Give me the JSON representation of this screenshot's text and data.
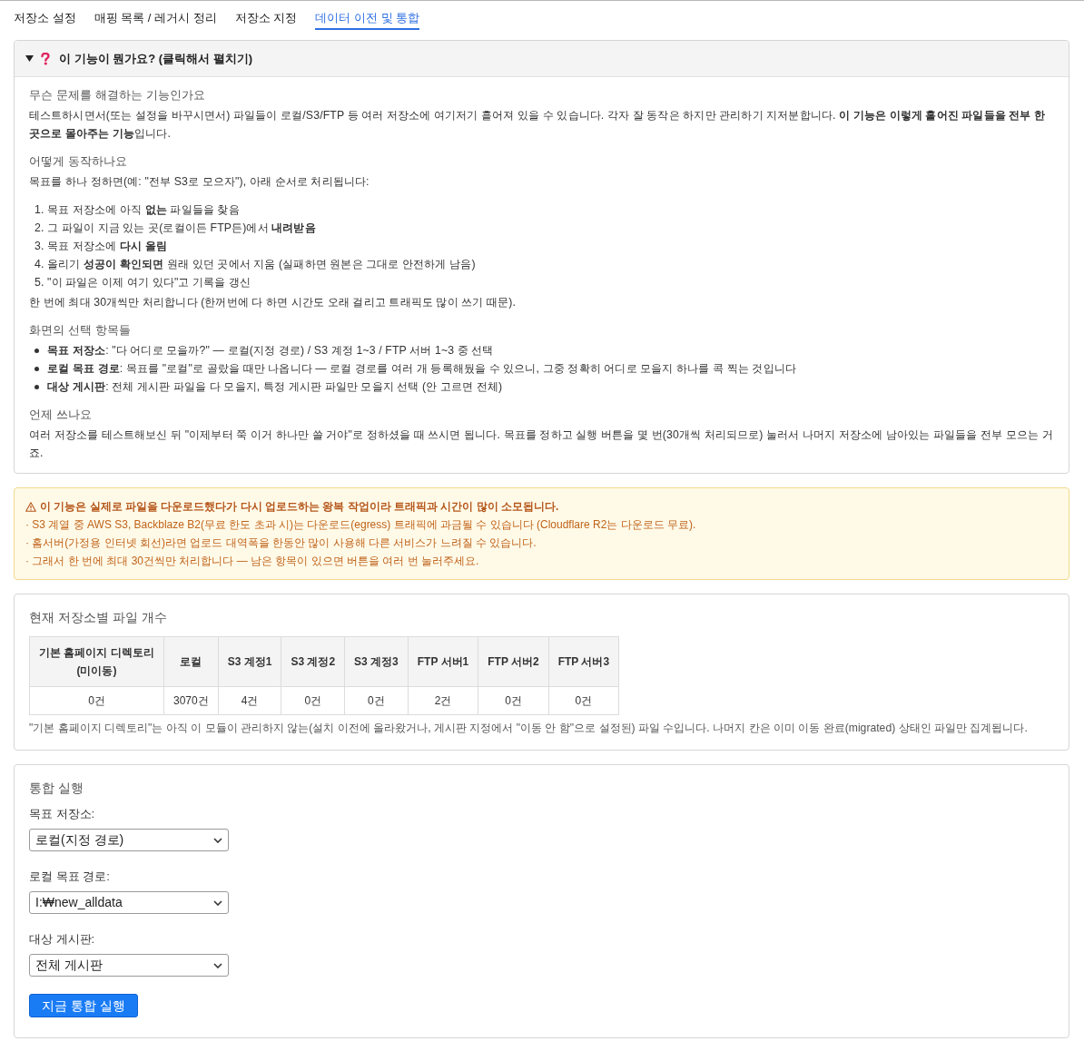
{
  "tabs": [
    {
      "label": "저장소 설정",
      "selected": false
    },
    {
      "label": "매핑 목록 / 레거시 정리",
      "selected": false
    },
    {
      "label": "저장소 지정",
      "selected": false
    },
    {
      "label": "데이터 이전 및 통합",
      "selected": true
    }
  ],
  "help_panel": {
    "summary": "이 기능이 뭔가요? (클릭해서 펼치기)",
    "expanded": true,
    "sections": [
      {
        "heading": "무슨 문제를 해결하는 기능인가요",
        "blocks": [
          {
            "kind": "paragraph",
            "text": "테스트하시면서(또는 설정을 바꾸시면서) 파일들이 로컬/S3/FTP 등 여러 저장소에 여기저기 흩어져 있을 수 있습니다. 각자 잘 동작은 하지만 관리하기 지저분합니다. **이 기능은 이렇게 흩어진 파일들을 전부 한 곳으로 몰아주는 기능**입니다."
          }
        ]
      },
      {
        "heading": "어떻게 동작하나요",
        "blocks": [
          {
            "kind": "paragraph",
            "text": "목표를 하나 정하면(예: \"전부 S3로 모으자\"), 아래 순서로 처리됩니다:"
          },
          {
            "kind": "ordered_list",
            "items": [
              {
                "number": "1.",
                "text": "목표 저장소에 아직 **없는** 파일들을 찾음"
              },
              {
                "number": "2.",
                "text": "그 파일이 지금 있는 곳(로컬이든 FTP든)에서 **내려받음**"
              },
              {
                "number": "3.",
                "text": "목표 저장소에 **다시 올림**"
              },
              {
                "number": "4.",
                "text": "올리기 **성공이 확인되면** 원래 있던 곳에서 지움 (실패하면 원본은 그대로 안전하게 남음)"
              },
              {
                "number": "5.",
                "text": "\"이 파일은 이제 여기 있다\"고 기록을 갱신"
              }
            ]
          },
          {
            "kind": "paragraph",
            "text": "한 번에 최대 30개씩만 처리합니다 (한꺼번에 다 하면 시간도 오래 걸리고 트래픽도 많이 쓰기 때문)."
          }
        ]
      },
      {
        "heading": "화면의 선택 항목들",
        "blocks": [
          {
            "kind": "bullet_list",
            "items": [
              {
                "text": "**목표 저장소**: \"다 어디로 모을까?\" — 로컬(지정 경로) / S3 계정 1~3 / FTP 서버 1~3 중 선택"
              },
              {
                "text": "**로컬 목표 경로**: 목표를 \"로컬\"로 골랐을 때만 나옵니다 — 로컬 경로를 여러 개 등록해뒀을 수 있으니, 그중 정확히 어디로 모을지 하나를 콕 찍는 것입니다"
              },
              {
                "text": "**대상 게시판**: 전체 게시판 파일을 다 모을지, 특정 게시판 파일만 모을지 선택 (안 고르면 전체)"
              }
            ]
          }
        ]
      },
      {
        "heading": "언제 쓰나요",
        "blocks": [
          {
            "kind": "paragraph",
            "text": "여러 저장소를 테스트해보신 뒤 \"이제부터 쭉 이거 하나만 쓸 거야\"로 정하셨을 때 쓰시면 됩니다. 목표를 정하고 실행 버튼을 몇 번(30개씩 처리되므로) 눌러서 나머지 저장소에 남아있는 파일들을 전부 모으는 거죠."
          }
        ]
      }
    ]
  },
  "warning": {
    "title": "이 기능은 실제로 파일을 다운로드했다가 다시 업로드하는 왕복 작업이라 트래픽과 시간이 많이 소모됩니다.",
    "lines": [
      "· S3 계열 중 AWS S3, Backblaze B2(무료 한도 초과 시)는 다운로드(egress) 트래픽에 과금될 수 있습니다 (Cloudflare R2는 다운로드 무료).",
      "· 홈서버(가정용 인터넷 회선)라면 업로드 대역폭을 한동안 많이 사용해 다른 서비스가 느려질 수 있습니다.",
      "· 그래서 한 번에 최대 30건씩만 처리합니다 — 남은 항목이 있으면 버튼을 여러 번 눌러주세요."
    ]
  },
  "file_counts": {
    "title": "현재 저장소별 파일 개수",
    "table": {
      "columns": [
        "기본 홈페이지 디렉토리\n(미이동)",
        "로컬",
        "S3 계정1",
        "S3 계정2",
        "S3 계정3",
        "FTP 서버1",
        "FTP 서버2",
        "FTP 서버3"
      ],
      "rows": [
        [
          "0건",
          "3070건",
          "4건",
          "0건",
          "0건",
          "2건",
          "0건",
          "0건"
        ]
      ]
    },
    "note": "\"기본 홈페이지 디렉토리\"는 아직 이 모듈이 관리하지 않는(설치 이전에 올라왔거나, 게시판 지정에서 \"이동 안 함\"으로 설정된) 파일 수입니다. 나머지 칸은 이미 이동 완료(migrated) 상태인 파일만 집계됩니다."
  },
  "merge_form": {
    "title": "통합 실행",
    "fields": [
      {
        "label": "목표 저장소:",
        "value": "로컬(지정 경로)"
      },
      {
        "label": "로컬 목표 경로:",
        "value": "I:₩new_alldata"
      },
      {
        "label": "대상 게시판:",
        "value": "전체 게시판"
      }
    ],
    "button": "지금 통합 실행"
  }
}
